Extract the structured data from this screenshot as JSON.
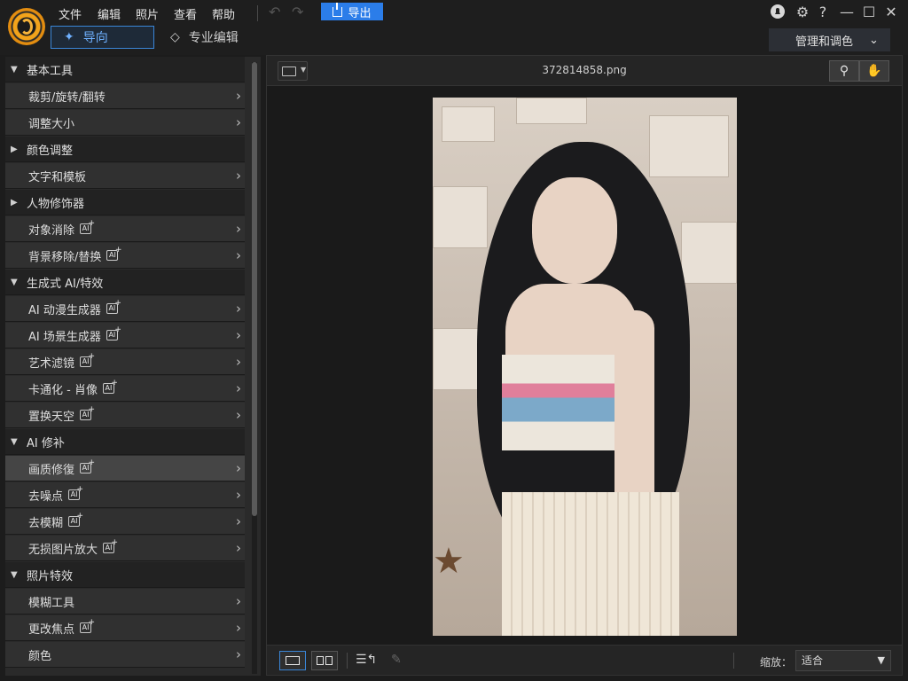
{
  "menu": [
    "文件",
    "编辑",
    "照片",
    "查看",
    "帮助"
  ],
  "export_label": "导出",
  "modes": {
    "guide": "导向",
    "pro": "专业编辑"
  },
  "manage_label": "管理和调色",
  "window_controls": {
    "help": "?"
  },
  "filename": "372814858.png",
  "zoom": {
    "label": "缩放：",
    "value": "适合"
  },
  "panel": [
    {
      "type": "section",
      "label": "基本工具",
      "expanded": true
    },
    {
      "type": "item",
      "label": "裁剪/旋转/翻转",
      "ai": false
    },
    {
      "type": "item",
      "label": "调整大小",
      "ai": false
    },
    {
      "type": "section",
      "label": "颜色调整",
      "expanded": false
    },
    {
      "type": "item",
      "label": "文字和模板",
      "ai": false
    },
    {
      "type": "section",
      "label": "人物修饰器",
      "expanded": false
    },
    {
      "type": "item",
      "label": "对象消除",
      "ai": true
    },
    {
      "type": "item",
      "label": "背景移除/替换",
      "ai": true
    },
    {
      "type": "section",
      "label": "生成式 AI/特效",
      "expanded": true
    },
    {
      "type": "item",
      "label": "AI 动漫生成器",
      "ai": true
    },
    {
      "type": "item",
      "label": "AI 场景生成器",
      "ai": true
    },
    {
      "type": "item",
      "label": "艺术滤镜",
      "ai": true
    },
    {
      "type": "item",
      "label": "卡通化 - 肖像",
      "ai": true
    },
    {
      "type": "item",
      "label": "置换天空",
      "ai": true
    },
    {
      "type": "section",
      "label": "AI 修补",
      "expanded": true
    },
    {
      "type": "item",
      "label": "画质修復",
      "ai": true,
      "selected": true
    },
    {
      "type": "item",
      "label": "去噪点",
      "ai": true
    },
    {
      "type": "item",
      "label": "去模糊",
      "ai": true
    },
    {
      "type": "item",
      "label": "无损图片放大",
      "ai": true
    },
    {
      "type": "section",
      "label": "照片特效",
      "expanded": true
    },
    {
      "type": "item",
      "label": "模糊工具",
      "ai": false
    },
    {
      "type": "item",
      "label": "更改焦点",
      "ai": true
    },
    {
      "type": "item",
      "label": "颜色",
      "ai": false
    }
  ],
  "icons": {
    "undo": "undo-icon",
    "redo": "redo-icon",
    "notification": "bell-icon",
    "settings": "gear-icon",
    "minimize": "minimize-icon",
    "maximize": "maximize-icon",
    "close": "close-icon"
  },
  "colors": {
    "accent": "#2b7de9",
    "guide_text": "#6fb1ff"
  }
}
